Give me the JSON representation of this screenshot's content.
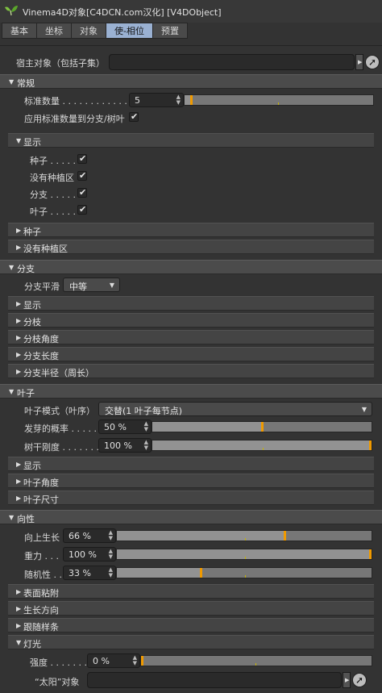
{
  "window": {
    "title": "Vinema4D对象[C4DCN.com汉化] [V4DObject]"
  },
  "tabs": [
    "基本",
    "坐标",
    "对象",
    "使-相位",
    "预置"
  ],
  "host": {
    "label": "宿主对象（包括子集）"
  },
  "general": {
    "header": "常规",
    "std_count_label": "标准数量 . . . . . . . . . . . . . . .",
    "std_count_value": "5",
    "std_count_fraction": 0.03,
    "apply_label": "应用标准数量到分支/树叶",
    "apply_checked": "✔"
  },
  "display": {
    "header": "显示",
    "items": [
      {
        "label": "种子 . . . . .",
        "mark": "✔"
      },
      {
        "label": "没有种植区",
        "mark": "✔"
      },
      {
        "label": "分支 . . . . .",
        "mark": "✔"
      },
      {
        "label": "叶子 . . . . .",
        "mark": "✔"
      }
    ]
  },
  "general_subs": [
    "种子",
    "没有种植区"
  ],
  "branch": {
    "header": "分支",
    "smooth_label": "分支平滑",
    "smooth_value": "中等",
    "subs": [
      "显示",
      "分枝",
      "分枝角度",
      "分支长度",
      "分支半径（周长）"
    ]
  },
  "leaf": {
    "header": "叶子",
    "mode_label": "叶子模式（叶序）",
    "mode_value": "交替(1 叶子每节点)",
    "sprout_label": "发芽的概率 . . . . .",
    "sprout_value": "50 %",
    "sprout_fraction": 0.5,
    "stiff_label": "树干刚度 . . . . . . .",
    "stiff_value": "100 %",
    "stiff_fraction": 1.0,
    "subs": [
      "显示",
      "叶子角度",
      "叶子尺寸"
    ]
  },
  "tropism": {
    "header": "向性",
    "grow_label": "向上生长",
    "grow_value": "66 %",
    "grow_fraction": 0.66,
    "gravity_label": "重力 . . .",
    "gravity_value": "100 %",
    "gravity_fraction": 1.0,
    "random_label": "随机性 . .",
    "random_value": "33 %",
    "random_fraction": 0.33,
    "subs": [
      "表面粘附",
      "生长方向",
      "跟随样条"
    ],
    "light": {
      "header": "灯光",
      "strength_label": "强度 . . . . . . . .",
      "strength_value": "0 %",
      "strength_fraction": 0.0,
      "sun_label": "“太阳”对象"
    }
  },
  "icons": {
    "expand": "triangle-down",
    "collapse": "triangle-right",
    "pick": "arrow-cursor"
  },
  "colors": {
    "accent_tab": "#9ab1d2",
    "slider_knob": "#f09a00"
  }
}
